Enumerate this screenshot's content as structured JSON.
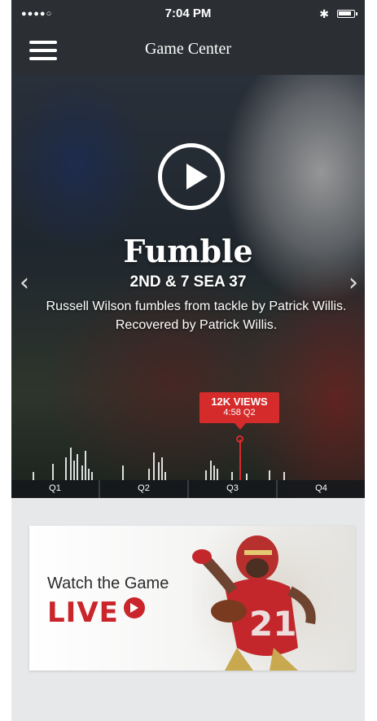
{
  "status_bar": {
    "signal": "●●●●○",
    "time": "7:04 PM",
    "bluetooth": "✱",
    "battery_icon": "battery-icon"
  },
  "nav": {
    "title": "Game Center",
    "menu_icon": "hamburger-icon"
  },
  "hero": {
    "play_icon": "play-icon",
    "headline": "Fumble",
    "subhead": "2ND & 7 SEA 37",
    "description": "Russell Wilson fumbles from tackle by Patrick Willis. Recovered by Patrick Willis.",
    "prev_arrow": "‹",
    "next_arrow": "›"
  },
  "timeline": {
    "views_label": "12K VIEWS",
    "time_label": "4:58 Q2",
    "quarters": [
      "Q1",
      "Q2",
      "Q3",
      "Q4"
    ]
  },
  "promo": {
    "line1": "Watch the Game",
    "line2": "LIVE",
    "accent_color": "#c9252b"
  },
  "colors": {
    "nav_bg": "#2b2f33",
    "accent_red": "#d52b2b",
    "page_bg": "#e6e8ea"
  }
}
